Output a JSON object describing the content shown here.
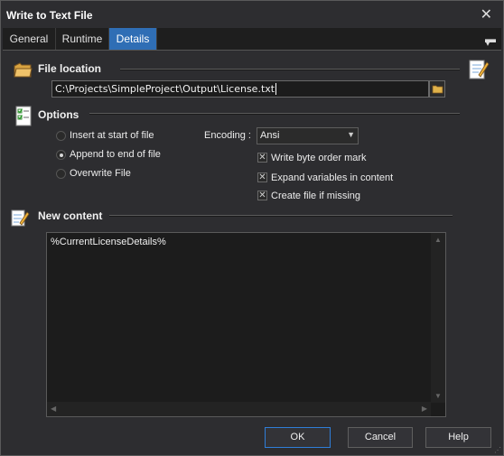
{
  "window": {
    "title": "Write to Text File"
  },
  "tabs": [
    {
      "label": "General"
    },
    {
      "label": "Runtime"
    },
    {
      "label": "Details"
    }
  ],
  "file_location": {
    "heading": "File location",
    "path": "C:\\Projects\\SimpleProject\\Output\\License.txt"
  },
  "options": {
    "heading": "Options",
    "radios": [
      {
        "label": "Insert at start of file",
        "selected": false
      },
      {
        "label": "Append to end of file",
        "selected": true
      },
      {
        "label": "Overwrite File",
        "selected": false
      }
    ],
    "encoding_label": "Encoding :",
    "encoding_value": "Ansi",
    "checks": [
      {
        "label": "Write byte order mark",
        "checked": true
      },
      {
        "label": "Expand variables in content",
        "checked": true
      },
      {
        "label": "Create file if missing",
        "checked": true
      }
    ]
  },
  "content": {
    "heading": "New content",
    "text": "%CurrentLicenseDetails%"
  },
  "buttons": {
    "ok": "OK",
    "cancel": "Cancel",
    "help": "Help"
  },
  "colors": {
    "accent": "#2f6eb5",
    "background": "#2d2d30"
  }
}
